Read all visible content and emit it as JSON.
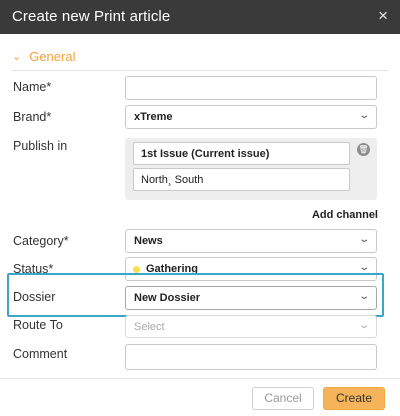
{
  "dialog": {
    "title": "Create new Print article",
    "close_icon": "×"
  },
  "section": {
    "label": "General",
    "chevron_icon": "⌄"
  },
  "fields": {
    "name": {
      "label": "Name*",
      "value": ""
    },
    "brand": {
      "label": "Brand*",
      "value": "xTreme"
    },
    "publish_in": {
      "label": "Publish in",
      "issue": "1st Issue (Current issue)",
      "editions": "North¸ South"
    },
    "add_channel": "Add channel",
    "category": {
      "label": "Category*",
      "value": "News"
    },
    "status": {
      "label": "Status*",
      "value": "Gathering",
      "dot_color": "#f4e04d"
    },
    "dossier": {
      "label": "Dossier",
      "value": "New Dossier"
    },
    "route_to": {
      "label": "Route To",
      "placeholder": "Select"
    },
    "comment": {
      "label": "Comment",
      "value": ""
    }
  },
  "buttons": {
    "cancel": "Cancel",
    "create": "Create"
  },
  "colors": {
    "accent": "#f2a23a",
    "highlight": "#3aa7c8",
    "create_bg": "#f5b45a",
    "titlebar": "#3a3a3a"
  }
}
